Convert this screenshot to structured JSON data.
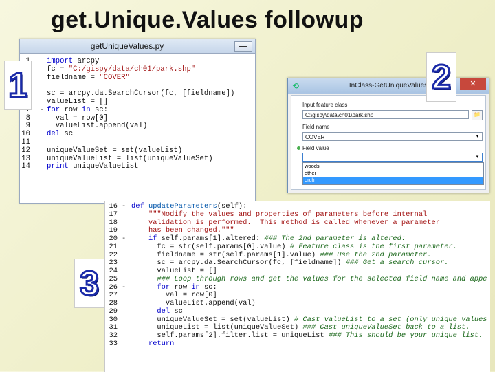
{
  "slide": {
    "title": "get.Unique.Values followup",
    "badges": [
      "1",
      "2",
      "3"
    ]
  },
  "window1": {
    "title": "getUniqueValues.py",
    "lines": [
      {
        "n": "1",
        "fold": "",
        "html": "<span class=\"kw\">import</span> arcpy"
      },
      {
        "n": "2",
        "fold": "",
        "html": "fc = <span class=\"str\">\"C:/gispy/data/ch01/park.shp\"</span>"
      },
      {
        "n": "3",
        "fold": "",
        "html": "fieldname = <span class=\"str\">\"COVER\"</span>"
      },
      {
        "n": "4",
        "fold": "",
        "html": ""
      },
      {
        "n": "5",
        "fold": "",
        "html": "sc = arcpy.da.SearchCursor(fc, [fieldname])"
      },
      {
        "n": "6",
        "fold": "",
        "html": "valueList = []"
      },
      {
        "n": "7",
        "fold": "-",
        "html": "<span class=\"kw\">for</span> row <span class=\"kw\">in</span> sc:"
      },
      {
        "n": "8",
        "fold": "",
        "html": "  val = row[0]"
      },
      {
        "n": "9",
        "fold": "",
        "html": "  valueList.append(val)"
      },
      {
        "n": "10",
        "fold": "",
        "html": "<span class=\"kw\">del</span> sc"
      },
      {
        "n": "11",
        "fold": "",
        "html": ""
      },
      {
        "n": "12",
        "fold": "",
        "html": "uniqueValueSet = set(valueList)"
      },
      {
        "n": "13",
        "fold": "",
        "html": "uniqueValueList = list(uniqueValueSet)"
      },
      {
        "n": "14",
        "fold": "",
        "html": "<span class=\"kw\">print</span> uniqueValueList"
      }
    ]
  },
  "window2": {
    "title": "InClass-GetUniqueValues",
    "close_label": "✕",
    "input_fc_label": "Input feature class",
    "input_fc_value": "C:\\gispy\\data\\ch01\\park.shp",
    "field_name_label": "Field name",
    "field_name_value": "COVER",
    "field_value_label": "Field value",
    "field_value_value": "",
    "options": [
      "woods",
      "other",
      "orch"
    ],
    "selected_option": "orch"
  },
  "window3": {
    "lines": [
      {
        "n": "16",
        "fold": "-",
        "html": "<span class=\"kw\">def</span> <span class=\"fn\">updateParameters</span>(self):"
      },
      {
        "n": "17",
        "fold": "",
        "html": "    <span class=\"str\">\"\"\"Modify the values and properties of parameters before internal</span>"
      },
      {
        "n": "18",
        "fold": "",
        "html": "<span class=\"str\">    validation is performed.  This method is called whenever a parameter</span>"
      },
      {
        "n": "19",
        "fold": "",
        "html": "<span class=\"str\">    has been changed.\"\"\"</span>"
      },
      {
        "n": "20",
        "fold": "-",
        "html": "    <span class=\"kw\">if</span> self.params[1].altered: <span class=\"cm\">### The 2nd parameter is altered:</span>"
      },
      {
        "n": "21",
        "fold": "",
        "html": "      fc = str(self.params[0].value) <span class=\"cm\"># Feature class is the first parameter.</span>"
      },
      {
        "n": "22",
        "fold": "",
        "html": "      fieldname = str(self.params[1].value) <span class=\"cm\">### Use the 2nd parameter.</span>"
      },
      {
        "n": "23",
        "fold": "",
        "html": "      sc = arcpy.da.SearchCursor(fc, [fieldname]) <span class=\"cm\">### Get a search cursor.</span>"
      },
      {
        "n": "24",
        "fold": "",
        "html": "      valueList = []"
      },
      {
        "n": "25",
        "fold": "",
        "html": "      <span class=\"cm\">### Loop through rows and get the values for the selected field name and appe</span>"
      },
      {
        "n": "26",
        "fold": "-",
        "html": "      <span class=\"kw\">for</span> row <span class=\"kw\">in</span> sc:"
      },
      {
        "n": "27",
        "fold": "",
        "html": "        val = row[0]"
      },
      {
        "n": "28",
        "fold": "",
        "html": "        valueList.append(val)"
      },
      {
        "n": "29",
        "fold": "",
        "html": "      <span class=\"kw\">del</span> sc"
      },
      {
        "n": "30",
        "fold": "",
        "html": "      uniqueValueSet = set(valueList) <span class=\"cm\"># Cast valueList to a set (only unique values</span>"
      },
      {
        "n": "31",
        "fold": "",
        "html": "      uniqueList = list(uniqueValueSet) <span class=\"cm\">### Cast uniqueValueSet back to a list.</span>"
      },
      {
        "n": "32",
        "fold": "",
        "html": "      self.params[2].filter.list = uniqueList <span class=\"cm\">### This should be your unique list.</span>"
      },
      {
        "n": "33",
        "fold": "",
        "html": "    <span class=\"kw\">return</span>"
      }
    ]
  }
}
